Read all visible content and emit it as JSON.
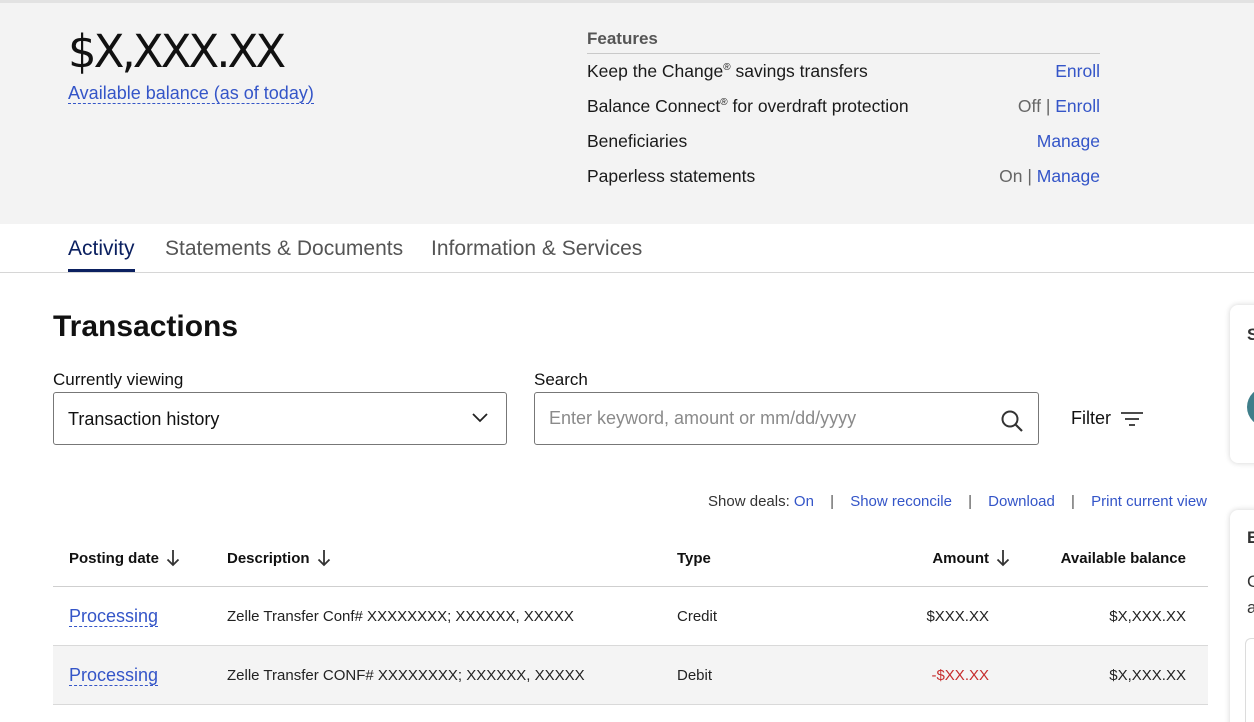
{
  "account": {
    "balance_amount": "$X,XXX.XX",
    "balance_label": "Available balance (as of today)"
  },
  "features": {
    "heading": "Features",
    "items": [
      {
        "name": "Keep the Change",
        "sup": "®",
        "name_suffix": " savings transfers",
        "status": "",
        "action": "Enroll"
      },
      {
        "name": "Balance Connect",
        "sup": "®",
        "name_suffix": " for overdraft protection",
        "status": "Off",
        "action": "Enroll"
      },
      {
        "name": "Beneficiaries",
        "sup": "",
        "name_suffix": "",
        "status": "",
        "action": "Manage"
      },
      {
        "name": "Paperless statements",
        "sup": "",
        "name_suffix": "",
        "status": "On",
        "action": "Manage"
      }
    ]
  },
  "tabs": [
    {
      "label": "Activity",
      "active": true
    },
    {
      "label": "Statements & Documents",
      "active": false
    },
    {
      "label": "Information & Services",
      "active": false
    }
  ],
  "transactions": {
    "title": "Transactions",
    "viewing_label": "Currently viewing",
    "viewing_value": "Transaction history",
    "search_label": "Search",
    "search_placeholder": "Enter keyword, amount or mm/dd/yyyy",
    "filter_label": "Filter",
    "toolbar": {
      "show_deals_label": "Show deals:",
      "show_deals_value": "On",
      "show_reconcile": "Show reconcile",
      "download": "Download",
      "print": "Print current view",
      "separator": "|"
    },
    "columns": {
      "date": "Posting date",
      "description": "Description",
      "type": "Type",
      "amount": "Amount",
      "balance": "Available balance"
    },
    "rows": [
      {
        "date": "Processing",
        "description": "Zelle Transfer Conf# XXXXXXXX; XXXXXX, XXXXX",
        "type": "Credit",
        "amount": "$XXX.XX",
        "balance": "$X,XXX.XX"
      },
      {
        "date": "Processing",
        "description": "Zelle Transfer CONF# XXXXXXXX; XXXXXX, XXXXX",
        "type": "Debit",
        "amount": "-$XX.XX",
        "balance": "$X,XXX.XX"
      }
    ]
  },
  "side_panel": {
    "card1_letter": "S",
    "card2_letter": "E",
    "card2_line1": "C",
    "card2_line2": "a"
  },
  "colors": {
    "link": "#3455c8",
    "active_tab": "#0b2060",
    "negative_amount": "#c62d2d",
    "summary_background": "#f3f3f3"
  },
  "icons": {
    "select_chevron": "chevron-down-icon",
    "search": "search-icon",
    "filter": "filter-icon",
    "sort": "arrow-down-icon"
  }
}
